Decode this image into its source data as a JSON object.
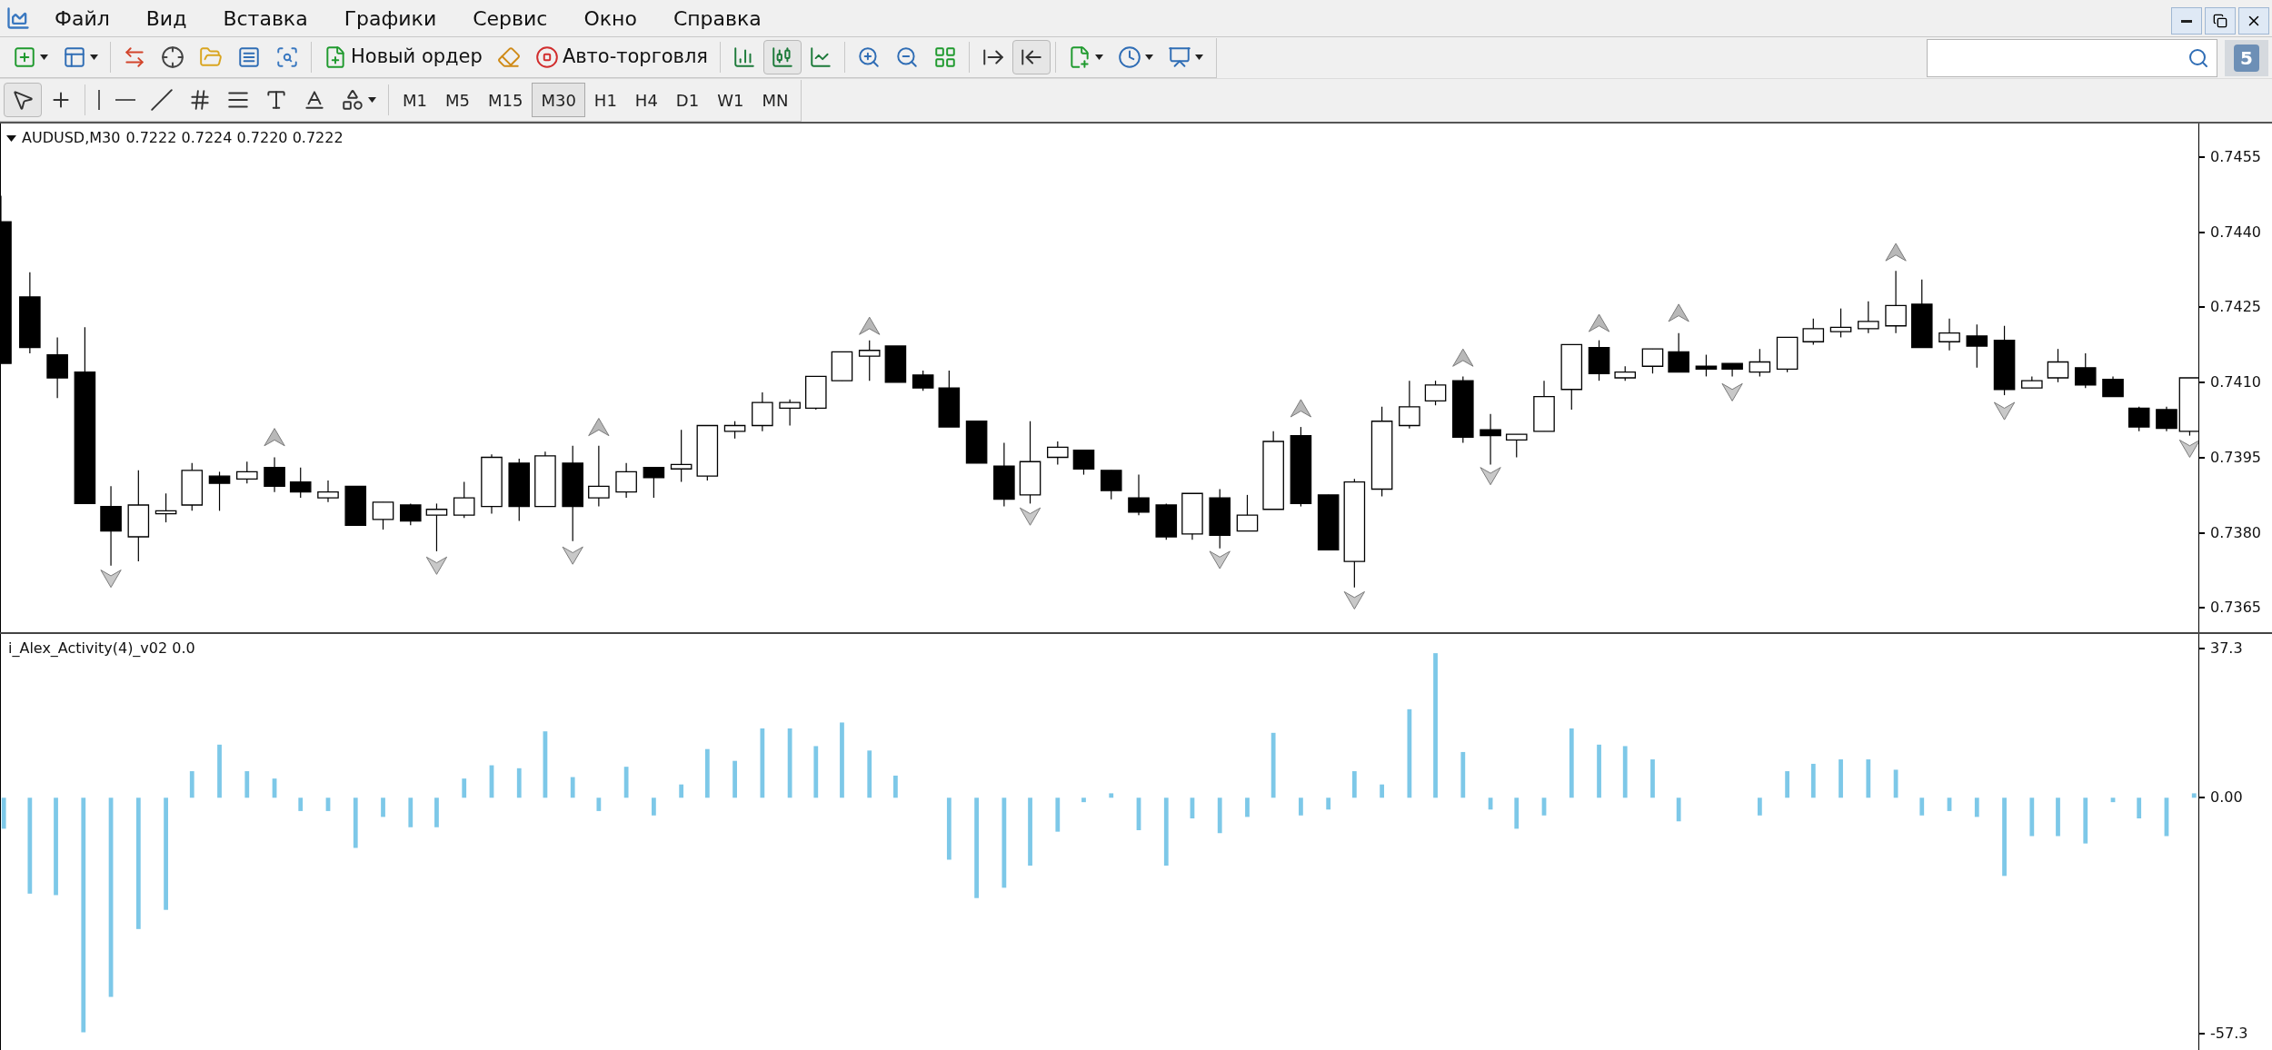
{
  "menu": [
    "Файл",
    "Вид",
    "Вставка",
    "Графики",
    "Сервис",
    "Окно",
    "Справка"
  ],
  "toolbar": {
    "new_order": "Новый ордер",
    "auto_trading": "Авто-торговля",
    "chart_types": [
      {
        "selected": false
      },
      {
        "selected": true
      },
      {
        "selected": false
      }
    ],
    "chart_options": [
      {
        "on": false
      },
      {
        "on": true
      }
    ]
  },
  "search": {
    "badge": "5"
  },
  "drawing_tools": [
    {
      "selected": true
    },
    {
      "selected": false
    },
    {
      "selected": false
    },
    {
      "selected": false
    },
    {
      "selected": false
    },
    {
      "selected": false
    },
    {
      "selected": false
    },
    {
      "selected": false
    },
    {
      "selected": false
    }
  ],
  "periods": [
    {
      "label": "M1",
      "selected": false
    },
    {
      "label": "M5",
      "selected": false
    },
    {
      "label": "M15",
      "selected": false
    },
    {
      "label": "M30",
      "selected": true
    },
    {
      "label": "H1",
      "selected": false
    },
    {
      "label": "H4",
      "selected": false
    },
    {
      "label": "D1",
      "selected": false
    },
    {
      "label": "W1",
      "selected": false
    },
    {
      "label": "MN",
      "selected": false
    }
  ],
  "chart": {
    "symbol": "AUDUSD,M30",
    "ohlc": "0.7222 0.7224 0.7220 0.7222",
    "price_ticks": [
      "0.7455",
      "0.7440",
      "0.7425",
      "0.7410",
      "0.7395",
      "0.7380",
      "0.7365"
    ]
  },
  "indicator": {
    "label": "i_Alex_Activity(4)_v02 0.0",
    "ticks": [
      "37.3",
      "0.00",
      "-57.3"
    ]
  }
}
